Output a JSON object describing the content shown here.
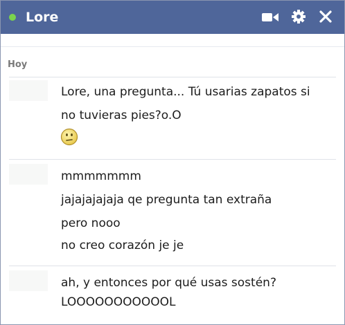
{
  "header": {
    "contact_name": "Lore",
    "online_status_color": "#7bd44d",
    "icons": [
      "video-call-icon",
      "settings-gear-icon",
      "close-icon"
    ]
  },
  "conversation": {
    "day_label": "Hoy",
    "messages": [
      {
        "lines": [
          "Lore, una pregunta... Tú usarias zapatos si",
          "no tuvieras pies?o.O"
        ],
        "emoticon": "confused-smiley-icon"
      },
      {
        "lines": [
          "mmmmmmm",
          "jajajajajaja qe pregunta tan extraña",
          "pero nooo",
          "no creo corazón je je"
        ]
      },
      {
        "lines": [
          "ah, y entonces por qué usas sostén?",
          "LOOOOOOOOOOOL"
        ]
      }
    ]
  }
}
